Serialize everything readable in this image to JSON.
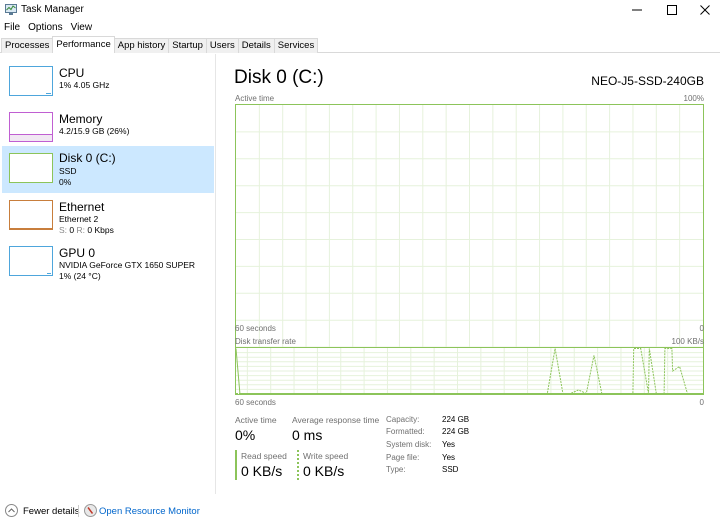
{
  "window": {
    "title": "Task Manager",
    "icon": "task-manager-icon",
    "controls": [
      "minimize",
      "maximize",
      "close"
    ]
  },
  "menu": [
    "File",
    "Options",
    "View"
  ],
  "tabs": [
    {
      "label": "Processes",
      "active": false
    },
    {
      "label": "Performance",
      "active": true
    },
    {
      "label": "App history",
      "active": false
    },
    {
      "label": "Startup",
      "active": false
    },
    {
      "label": "Users",
      "active": false
    },
    {
      "label": "Details",
      "active": false
    },
    {
      "label": "Services",
      "active": false
    }
  ],
  "sidebar": {
    "items": [
      {
        "title": "CPU",
        "line1": "1% 4.05 GHz",
        "line2": "",
        "color": "#4ea6dc",
        "selected": false
      },
      {
        "title": "Memory",
        "line1": "4.2/15.9 GB (26%)",
        "line2": "",
        "color": "#c05fd2",
        "selected": false
      },
      {
        "title": "Disk 0 (C:)",
        "line1": "SSD",
        "line2": "0%",
        "color": "#8cc45a",
        "selected": true
      },
      {
        "title": "Ethernet",
        "line1": "Ethernet 2",
        "line2_s": "S:",
        "line2_s_val": "0",
        "line2_r": "R:",
        "line2_r_val": "0 Kbps",
        "color": "#c87e3c",
        "selected": false
      },
      {
        "title": "GPU 0",
        "line1": "NVIDIA GeForce GTX 1650 SUPER",
        "line2": "1% (24 °C)",
        "color": "#4ea6dc",
        "selected": false
      }
    ]
  },
  "main": {
    "title": "Disk 0 (C:)",
    "model": "NEO-J5-SSD-240GB",
    "accent": "#8cc45a",
    "active_graph": {
      "label": "Active time",
      "max_label": "100%",
      "time_label": "60 seconds",
      "min_label": "0"
    },
    "transfer_graph": {
      "label": "Disk transfer rate",
      "max_label": "100 KB/s",
      "time_label": "60 seconds",
      "min_label": "0"
    },
    "stats": {
      "active_time_label": "Active time",
      "active_time_value": "0%",
      "avg_response_label": "Average response time",
      "avg_response_value": "0 ms",
      "read_speed_label": "Read speed",
      "read_speed_value": "0 KB/s",
      "write_speed_label": "Write speed",
      "write_speed_value": "0 KB/s"
    },
    "properties": [
      {
        "label": "Capacity:",
        "value": "224 GB"
      },
      {
        "label": "Formatted:",
        "value": "224 GB"
      },
      {
        "label": "System disk:",
        "value": "Yes"
      },
      {
        "label": "Page file:",
        "value": "Yes"
      },
      {
        "label": "Type:",
        "value": "SSD"
      }
    ]
  },
  "footer": {
    "fewer_details": "Fewer details",
    "resource_monitor": "Open Resource Monitor"
  },
  "chart_data": [
    {
      "type": "line",
      "title": "Active time",
      "xlabel": "60 seconds",
      "ylabel": "",
      "ylim": [
        0,
        100
      ],
      "grid": true,
      "x": [
        0,
        1,
        2,
        3,
        4,
        5,
        6,
        7,
        8,
        9,
        10,
        11,
        12,
        13,
        14,
        15,
        16,
        17,
        18,
        19,
        20,
        21,
        22,
        23,
        24,
        25,
        26,
        27,
        28,
        29,
        30,
        31,
        32,
        33,
        34,
        35,
        36,
        37,
        38,
        39,
        40,
        41,
        42,
        43,
        44,
        45,
        46,
        47,
        48,
        49,
        50,
        51,
        52,
        53,
        54,
        55,
        56,
        57,
        58,
        59,
        60
      ],
      "series": [
        {
          "name": "Active time (%)",
          "values": [
            0,
            0,
            0,
            0,
            0,
            0,
            0,
            0,
            0,
            0,
            0,
            0,
            0,
            0,
            0,
            0,
            0,
            0,
            0,
            0,
            0,
            0,
            0,
            0,
            0,
            0,
            0,
            0,
            0,
            0,
            0,
            0,
            0,
            0,
            0,
            0,
            0,
            0,
            0,
            0,
            0,
            0,
            0,
            0,
            0,
            0,
            0,
            0,
            0,
            0,
            0,
            0,
            0,
            0,
            0,
            0,
            1,
            1,
            0,
            0,
            0
          ]
        }
      ]
    },
    {
      "type": "line",
      "title": "Disk transfer rate",
      "xlabel": "60 seconds",
      "ylabel": "KB/s",
      "ylim": [
        0,
        100
      ],
      "grid": true,
      "series": [
        {
          "name": "Read speed",
          "style": "solid",
          "x": [
            0,
            0.5,
            1,
            2,
            40,
            41,
            42,
            43,
            44,
            45,
            46,
            47,
            48,
            49,
            50,
            51,
            52,
            53,
            54,
            55,
            56,
            57,
            58,
            59,
            60
          ],
          "values": [
            100,
            0,
            0,
            0,
            0,
            0,
            0,
            0,
            0,
            0,
            0,
            0,
            0,
            0,
            0,
            0,
            0,
            0,
            0,
            0,
            0,
            0,
            0,
            0,
            0
          ]
        },
        {
          "name": "Write speed",
          "style": "dashed",
          "x": [
            0,
            39,
            40,
            41,
            42,
            43,
            44,
            45,
            46,
            47,
            48,
            49,
            50,
            51,
            51.1,
            52,
            53,
            53.1,
            54,
            55,
            55.1,
            56,
            56.1,
            57,
            58,
            59,
            60
          ],
          "values": [
            0,
            0,
            0,
            100,
            0,
            0,
            8,
            0,
            85,
            0,
            0,
            0,
            0,
            0,
            100,
            100,
            0,
            100,
            0,
            0,
            100,
            100,
            50,
            60,
            0,
            0,
            0
          ]
        }
      ]
    }
  ]
}
